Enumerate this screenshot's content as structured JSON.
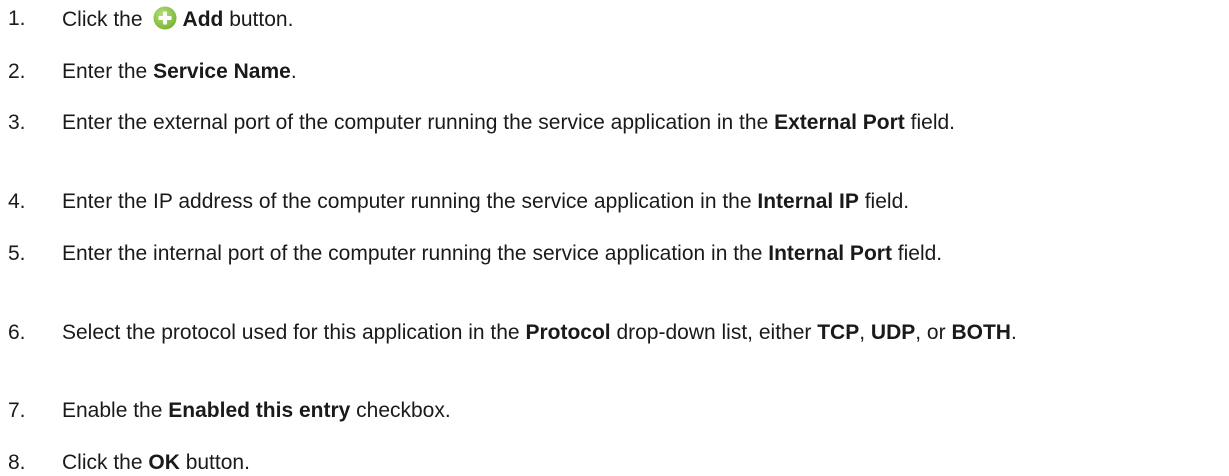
{
  "steps": [
    {
      "number": "1.",
      "pre": "Click the",
      "bold": "Add",
      "post": " button."
    },
    {
      "number": "2.",
      "pre": "Enter the ",
      "bold": "Service Name",
      "post": "."
    },
    {
      "number": "3.",
      "pre": "Enter the external port of the computer running the service application in the ",
      "bold": "External Port",
      "post": " field."
    },
    {
      "number": "4.",
      "pre": "Enter the IP address of the computer running the service application in the ",
      "bold": "Internal IP",
      "post": " field."
    },
    {
      "number": "5.",
      "pre": "Enter the internal port of the computer running the service application in the ",
      "bold": "Internal Port",
      "post": " field."
    },
    {
      "number": "6.",
      "pre": "Select the protocol used for this application in the ",
      "bold": "Protocol",
      "mid1": " drop-down list, either ",
      "bold2": "TCP",
      "mid2": ", ",
      "bold3": "UDP",
      "mid3": ", or ",
      "bold4": "BOTH",
      "post": "."
    },
    {
      "number": "7.",
      "pre": "Enable the ",
      "bold": "Enabled this entry",
      "post": " checkbox."
    },
    {
      "number": "8.",
      "pre": "Click the ",
      "bold": "OK",
      "post": " button."
    }
  ],
  "icons": {
    "add": "plus-circle-icon",
    "add_color": "#8cc63f"
  }
}
